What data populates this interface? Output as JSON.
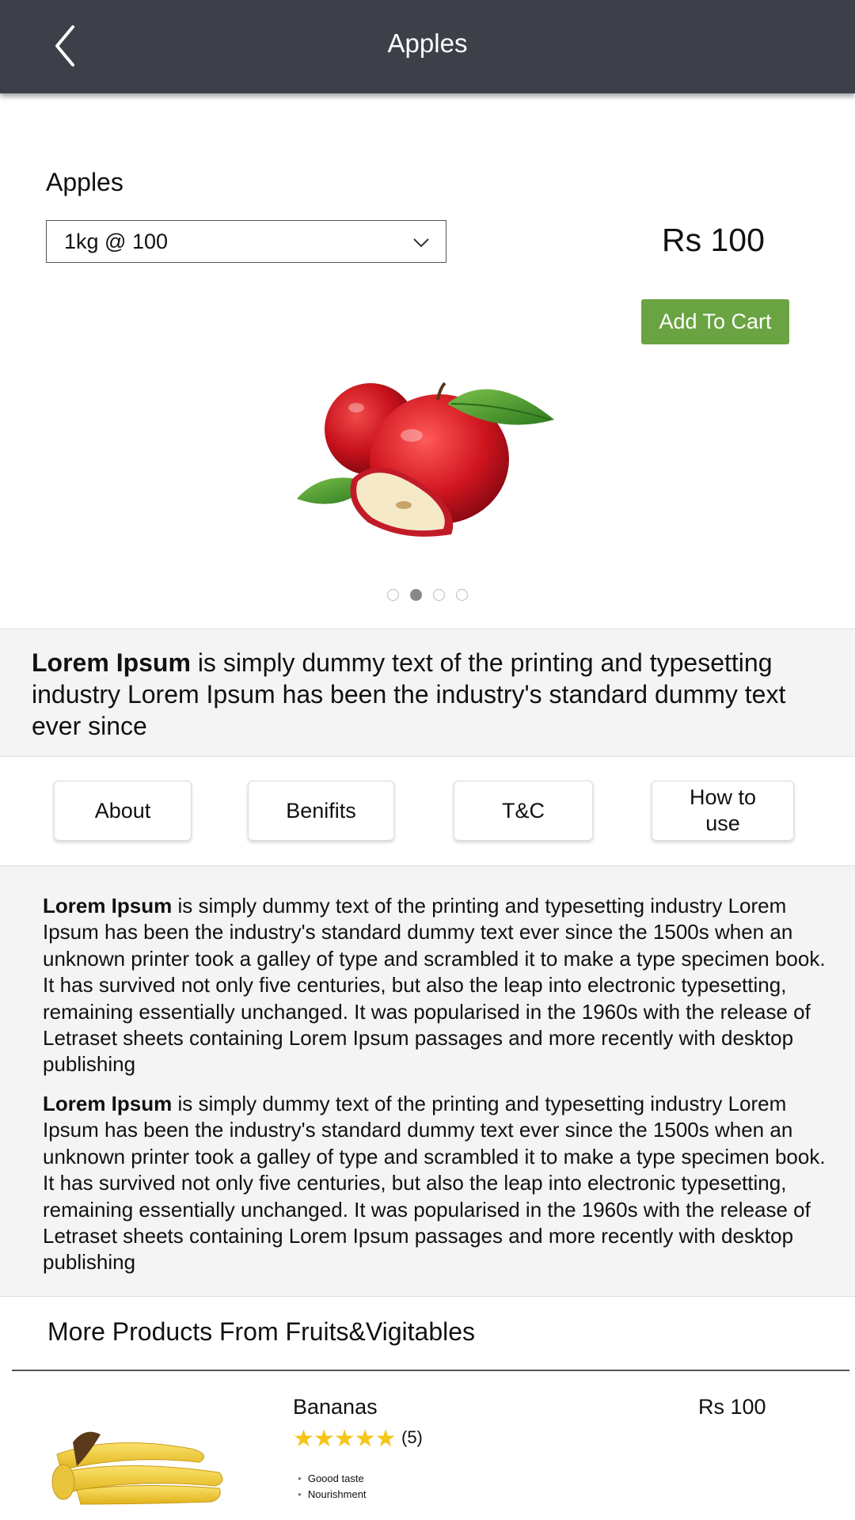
{
  "header": {
    "title": "Apples",
    "back_icon": "chevron-left-icon"
  },
  "product": {
    "name": "Apples",
    "quantity_selected": "1kg @ 100",
    "price": "Rs 100",
    "add_to_cart_label": "Add To Cart",
    "carousel": {
      "total": 4,
      "active_index": 1
    }
  },
  "summary": {
    "bold": "Lorem Ipsum",
    "text": " is simply dummy text of the printing and typesetting industry Lorem Ipsum has been the industry's standard dummy text ever since"
  },
  "tabs": [
    {
      "label": "About"
    },
    {
      "label": "Benifits"
    },
    {
      "label": "T&C"
    },
    {
      "label": "How to use"
    }
  ],
  "details": [
    {
      "bold": "Lorem Ipsum",
      "text": " is simply dummy text of the printing and typesetting industry Lorem Ipsum has been the industry's standard dummy text ever since the 1500s when an unknown printer took a galley of type and scrambled it to make a type specimen book. It has survived not only five centuries, but also the leap into electronic typesetting, remaining essentially unchanged. It was popularised in the 1960s with the release of Letraset sheets containing Lorem Ipsum passages and more recently with desktop publishing"
    },
    {
      "bold": "Lorem Ipsum",
      "text": " is simply dummy text of the printing and typesetting industry Lorem Ipsum has been the industry's standard dummy text ever since the 1500s when an unknown printer took a galley of type and scrambled it to make a type specimen book. It has survived not only five centuries, but also the leap into electronic typesetting, remaining essentially unchanged. It was popularised in the 1960s with the release of Letraset sheets containing Lorem Ipsum passages and more recently with desktop publishing"
    }
  ],
  "more_products": {
    "title": "More Products From Fruits&Vigitables",
    "items": [
      {
        "name": "Bananas",
        "price": "Rs 100",
        "stars": "★★★★★",
        "rating": "(5)",
        "features": [
          "Goood taste",
          "Nourishment"
        ]
      }
    ]
  },
  "colors": {
    "header_bg": "#3d4049",
    "accent_green": "#6aa341",
    "star": "#f5c518"
  }
}
